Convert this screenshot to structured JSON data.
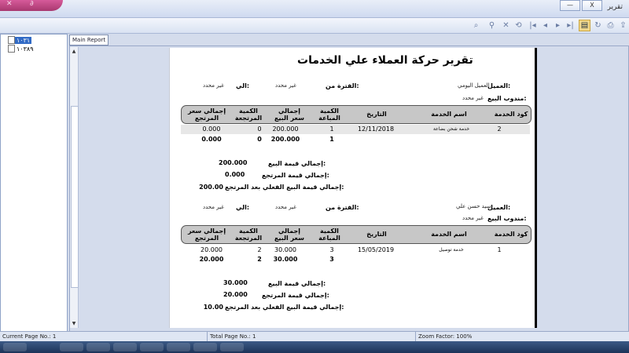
{
  "window": {
    "title": "تقرير",
    "buttons": {
      "minimize": "—",
      "close": "X"
    }
  },
  "tree": {
    "items": [
      {
        "label": "١٠٣١",
        "selected": true
      },
      {
        "label": "١٠٣٨٩",
        "selected": false
      }
    ]
  },
  "tab": {
    "label": "Main Report"
  },
  "report": {
    "title": "تقرير حركة العملاء علي الخدمات",
    "labels": {
      "customer": "العميل:",
      "period_from": "الفترة من:",
      "to": "الي:",
      "salesman": "مندوب البيع:",
      "total_sales": "إجمالي قيمة البيع:",
      "total_returns": "إجمالي قيمة المرتجع:",
      "net_sales": "إجمالي قيمة البيع الفعلي بعد المرتجع:"
    },
    "columns": {
      "code": "كود الخدمة",
      "name": "اسم الخدمة",
      "date": "التاريخ",
      "qty_sold": "الكمية المباعة",
      "total_sale": "إجمالي سعر البيع",
      "qty_returned": "الكمية المرتجعة",
      "total_return": "إجمالي سعر المرتجع"
    },
    "groups": [
      {
        "customer": "العميل اليومي",
        "period_from": "غير محدد",
        "to": "غير محدد",
        "salesman": "غير محدد",
        "rows": [
          {
            "code": "2",
            "name": "خدمة شحن بضاعة",
            "date": "12/11/2018",
            "qty_sold": "1",
            "total_sale": "200.000",
            "qty_returned": "0",
            "total_return": "0.000"
          }
        ],
        "totals": {
          "qty_sold": "1",
          "total_sale": "200.000",
          "qty_returned": "0",
          "total_return": "0.000"
        },
        "summary": {
          "total_sales": "200.000",
          "total_returns": "0.000",
          "net_sales": "200.00"
        }
      },
      {
        "customer": "سيد حسن علي",
        "period_from": "غير محدد",
        "to": "غير محدد",
        "salesman": "غير محدد",
        "rows": [
          {
            "code": "1",
            "name": "خدمة توصيل",
            "date": "15/05/2019",
            "qty_sold": "3",
            "total_sale": "30.000",
            "qty_returned": "2",
            "total_return": "20.000"
          }
        ],
        "totals": {
          "qty_sold": "3",
          "total_sale": "30.000",
          "qty_returned": "2",
          "total_return": "20.000"
        },
        "summary": {
          "total_sales": "30.000",
          "total_returns": "20.000",
          "net_sales": "10.00"
        }
      }
    ]
  },
  "status": {
    "current_page": "Current Page No.: 1",
    "total_page": "Total Page No.: 1",
    "zoom": "Zoom Factor: 100%"
  }
}
